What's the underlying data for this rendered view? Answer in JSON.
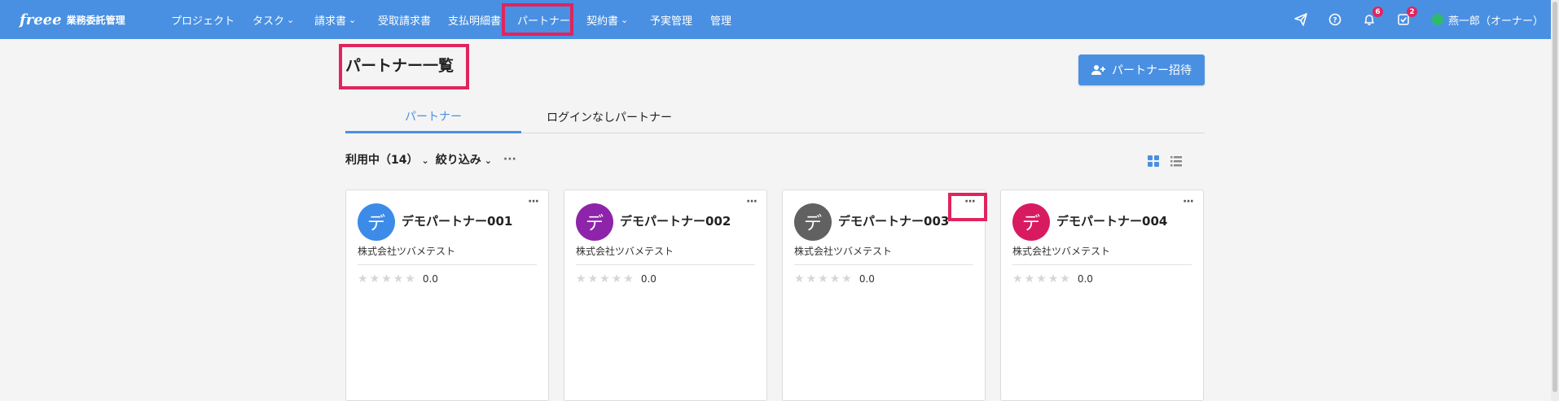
{
  "header": {
    "logo_mark": "freee",
    "logo_text": "業務委託管理",
    "nav": [
      {
        "label": "プロジェクト",
        "dropdown": false
      },
      {
        "label": "タスク",
        "dropdown": true
      },
      {
        "label": "請求書",
        "dropdown": true
      },
      {
        "label": "受取請求書",
        "dropdown": false
      },
      {
        "label": "支払明細書",
        "dropdown": false
      },
      {
        "label": "パートナー",
        "dropdown": false,
        "active": true
      },
      {
        "label": "契約書",
        "dropdown": true
      },
      {
        "label": "予実管理",
        "dropdown": false
      },
      {
        "label": "管理",
        "dropdown": false
      }
    ],
    "icons": {
      "send": "send-icon",
      "help": "help-icon",
      "notifications": "bell-icon",
      "tasks": "check-box-icon"
    },
    "notifications_count": "6",
    "tasks_count": "2",
    "user_name": "燕一郎（オーナー）"
  },
  "page": {
    "title": "パートナー一覧",
    "invite_button": "パートナー招待",
    "tabs": [
      {
        "label": "パートナー",
        "active": true
      },
      {
        "label": "ログインなしパートナー",
        "active": false
      }
    ],
    "filter": {
      "status": "利用中（14）",
      "narrow": "絞り込み",
      "more": "···"
    },
    "view_modes": [
      "grid-view-icon",
      "list-view-icon"
    ]
  },
  "partners": [
    {
      "initial": "デ",
      "name": "デモパートナー001",
      "company": "株式会社ツバメテスト",
      "rating": "0.0",
      "color": "#3d8be8"
    },
    {
      "initial": "デ",
      "name": "デモパートナー002",
      "company": "株式会社ツバメテスト",
      "rating": "0.0",
      "color": "#8e24aa"
    },
    {
      "initial": "デ",
      "name": "デモパートナー003",
      "company": "株式会社ツバメテスト",
      "rating": "0.0",
      "color": "#616161"
    },
    {
      "initial": "デ",
      "name": "デモパートナー004",
      "company": "株式会社ツバメテスト",
      "rating": "0.0",
      "color": "#d81b60"
    }
  ],
  "colors": {
    "brand_blue": "#4a90e2",
    "highlight": "#e0245e",
    "badge_red": "#e0245e",
    "star_empty": "#d6d6d6"
  }
}
